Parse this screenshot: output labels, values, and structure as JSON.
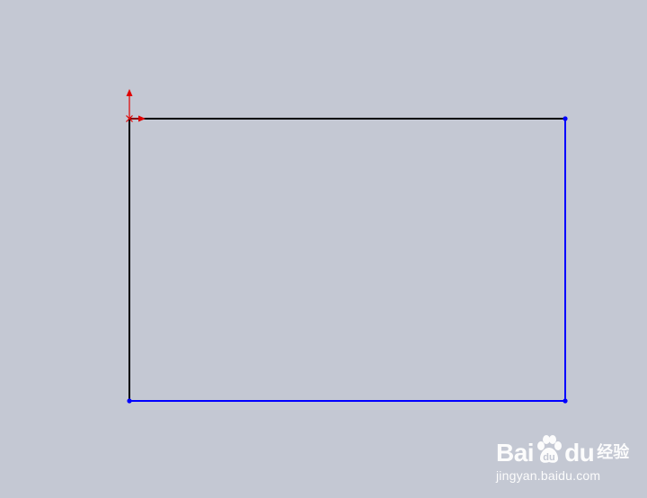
{
  "colors": {
    "background": "#c4c8d3",
    "line_defined": "#000000",
    "line_underdefined": "#0000ff",
    "origin": "#e00000",
    "endpoint": "#0000ff"
  },
  "icons": {
    "origin": "sketch-origin-icon",
    "logo": "baidu-paw-icon"
  },
  "watermark": {
    "brand_left": "Bai",
    "brand_right": "du",
    "product": "经验",
    "url": "jingyan.baidu.com"
  }
}
